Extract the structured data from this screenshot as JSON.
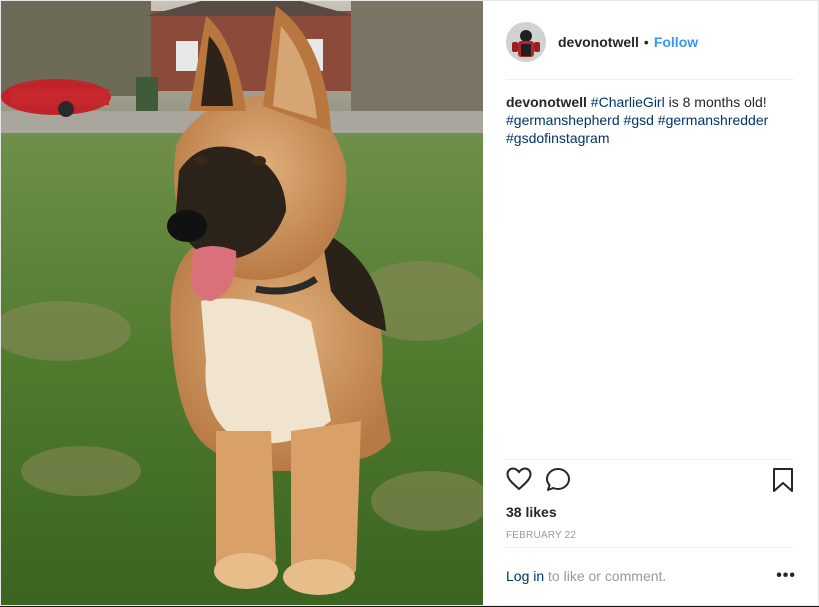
{
  "post": {
    "username": "devonotwell",
    "separator": "•",
    "follow_label": "Follow",
    "caption": {
      "user": "devonotwell",
      "tag1": "#CharlieGirl",
      "text": " is 8 months old!",
      "tags": [
        "#germanshepherd",
        "#gsd",
        "#germanshredder",
        "#gsdofinstagram"
      ]
    },
    "actions": {
      "like_icon": "heart-icon",
      "comment_icon": "comment-icon",
      "save_icon": "bookmark-icon"
    },
    "likes": "38 likes",
    "date": "FEBRUARY 22",
    "login_link": "Log in",
    "login_text": " to like or comment.",
    "more_label": "•••"
  },
  "colors": {
    "link": "#003569",
    "follow": "#3897f0",
    "text": "#262626",
    "muted": "#999999"
  }
}
